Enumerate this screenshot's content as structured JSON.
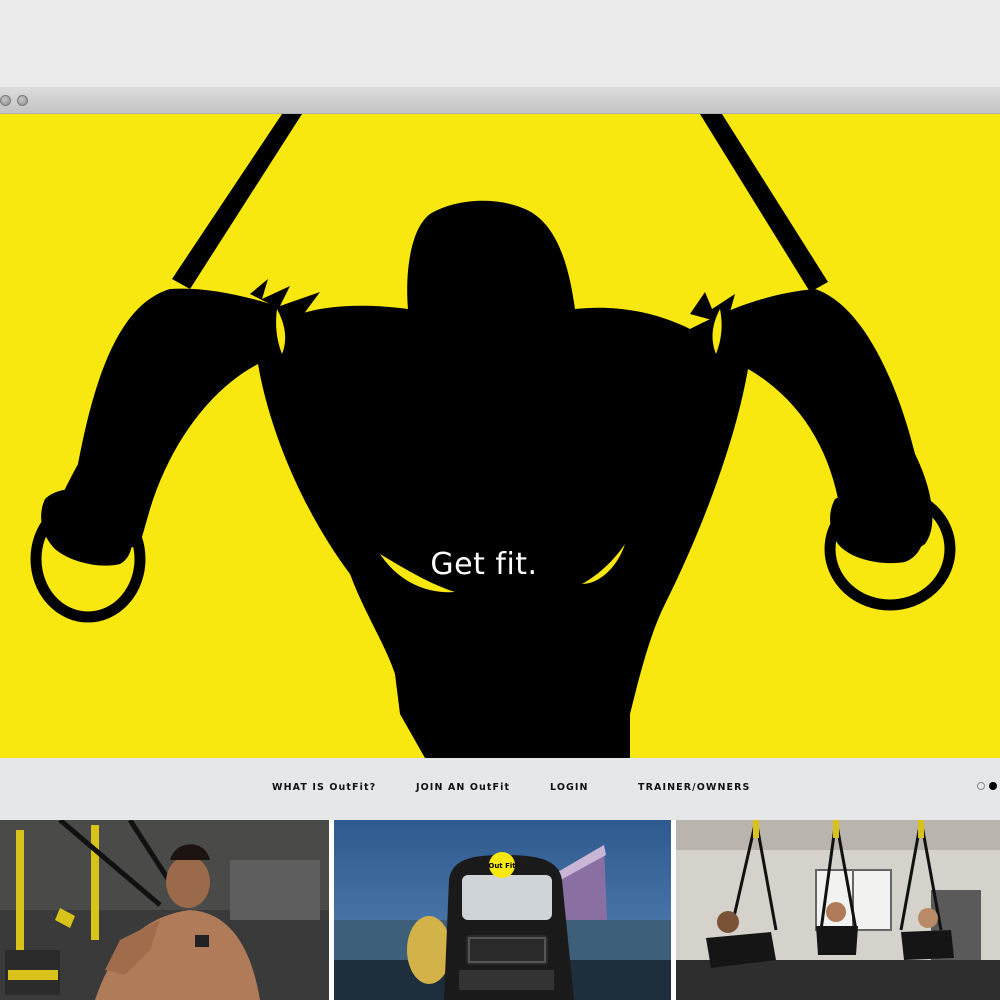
{
  "hero": {
    "headline": "Get fit."
  },
  "nav": {
    "items": [
      {
        "label": "WHAT IS OutFit?"
      },
      {
        "label": "JOIN AN OutFit"
      },
      {
        "label": "LOGIN"
      },
      {
        "label": "TRAINER/OWNERS"
      }
    ]
  },
  "carousel": {
    "active_index": 2,
    "count": 2
  },
  "tiles": {
    "van_logo": "Out Fit"
  },
  "colors": {
    "brand_yellow": "#f8e80f",
    "silhouette": "#000000",
    "nav_background": "#e6e7e8"
  },
  "icons": [
    "window-close-icon",
    "window-minimize-icon"
  ]
}
